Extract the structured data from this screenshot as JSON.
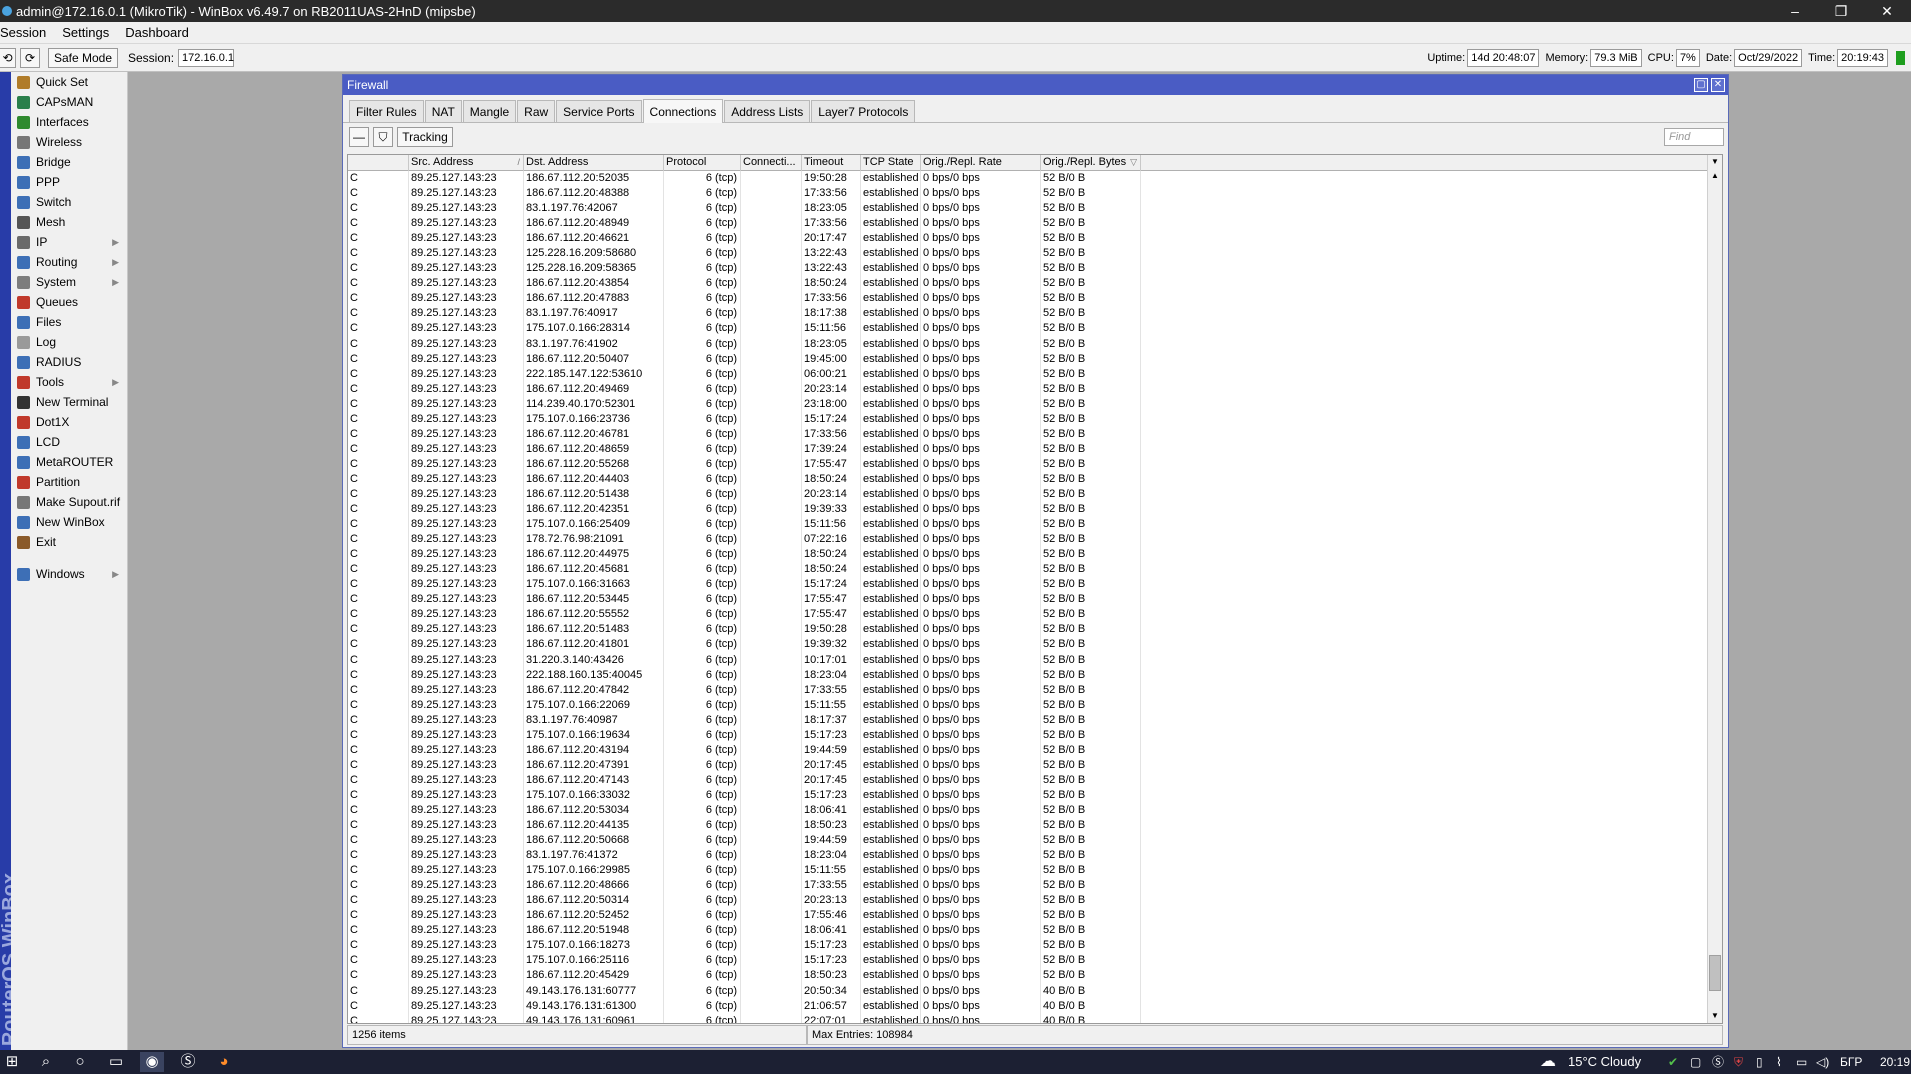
{
  "window": {
    "title": "admin@172.16.0.1 (MikroTik) - WinBox v6.49.7 on RB2011UAS-2HnD (mipsbe)",
    "controls": [
      "–",
      "❐",
      "✕"
    ]
  },
  "menu": [
    "Session",
    "Settings",
    "Dashboard"
  ],
  "toolbar": {
    "safe_mode": "Safe Mode",
    "session_label": "Session:",
    "session_value": "172.16.0.1",
    "uptime_label": "Uptime:",
    "uptime_value": "14d 20:48:07",
    "memory_label": "Memory:",
    "memory_value": "79.3 MiB",
    "cpu_label": "CPU:",
    "cpu_value": "7%",
    "date_label": "Date:",
    "date_value": "Oct/29/2022",
    "time_label": "Time:",
    "time_value": "20:19:43"
  },
  "brand_vertical": "RouterOS WinBox",
  "sidebar": [
    {
      "label": "Quick Set",
      "icon": "wand-icon",
      "color": "#b07c2a"
    },
    {
      "label": "CAPsMAN",
      "icon": "capsman-icon",
      "color": "#2a7f4b"
    },
    {
      "label": "Interfaces",
      "icon": "interfaces-icon",
      "color": "#2f8a2f"
    },
    {
      "label": "Wireless",
      "icon": "wireless-icon",
      "color": "#777777"
    },
    {
      "label": "Bridge",
      "icon": "bridge-icon",
      "color": "#3d6fb6"
    },
    {
      "label": "PPP",
      "icon": "ppp-icon",
      "color": "#3d6fb6"
    },
    {
      "label": "Switch",
      "icon": "switch-icon",
      "color": "#3d6fb6"
    },
    {
      "label": "Mesh",
      "icon": "mesh-icon",
      "color": "#555555"
    },
    {
      "label": "IP",
      "icon": "ip-icon",
      "color": "#6a6a6a",
      "submenu": true
    },
    {
      "label": "Routing",
      "icon": "routing-icon",
      "color": "#3d6fb6",
      "submenu": true
    },
    {
      "label": "System",
      "icon": "system-icon",
      "color": "#7d7d7d",
      "submenu": true
    },
    {
      "label": "Queues",
      "icon": "queues-icon",
      "color": "#c0392b"
    },
    {
      "label": "Files",
      "icon": "files-icon",
      "color": "#3d6fb6"
    },
    {
      "label": "Log",
      "icon": "log-icon",
      "color": "#9a9a9a"
    },
    {
      "label": "RADIUS",
      "icon": "radius-icon",
      "color": "#3d6fb6"
    },
    {
      "label": "Tools",
      "icon": "tools-icon",
      "color": "#c0392b",
      "submenu": true
    },
    {
      "label": "New Terminal",
      "icon": "terminal-icon",
      "color": "#333333"
    },
    {
      "label": "Dot1X",
      "icon": "dot1x-icon",
      "color": "#c0392b"
    },
    {
      "label": "LCD",
      "icon": "lcd-icon",
      "color": "#3d6fb6"
    },
    {
      "label": "MetaROUTER",
      "icon": "metarouter-icon",
      "color": "#3d6fb6"
    },
    {
      "label": "Partition",
      "icon": "partition-icon",
      "color": "#c0392b"
    },
    {
      "label": "Make Supout.rif",
      "icon": "supout-icon",
      "color": "#777777"
    },
    {
      "label": "New WinBox",
      "icon": "winbox-icon",
      "color": "#3d6fb6"
    },
    {
      "label": "Exit",
      "icon": "exit-icon",
      "color": "#8a5a2a"
    }
  ],
  "sidebar_windows": {
    "label": "Windows",
    "icon": "windows-icon",
    "color": "#3d6fb6"
  },
  "firewall": {
    "title": "Firewall",
    "tabs": [
      "Filter Rules",
      "NAT",
      "Mangle",
      "Raw",
      "Service Ports",
      "Connections",
      "Address Lists",
      "Layer7 Protocols"
    ],
    "active_tab": "Connections",
    "tracking_button": "Tracking",
    "find_placeholder": "Find",
    "columns": [
      "",
      "Src. Address",
      "Dst. Address",
      "Protocol",
      "Connecti...",
      "Timeout",
      "TCP State",
      "Orig./Repl. Rate",
      "Orig./Repl. Bytes"
    ],
    "rows": [
      [
        "C",
        "89.25.127.143:23",
        "186.67.112.20:52035",
        "6 (tcp)",
        "",
        "19:50:28",
        "established",
        "0 bps/0 bps",
        "52 B/0 B"
      ],
      [
        "C",
        "89.25.127.143:23",
        "186.67.112.20:48388",
        "6 (tcp)",
        "",
        "17:33:56",
        "established",
        "0 bps/0 bps",
        "52 B/0 B"
      ],
      [
        "C",
        "89.25.127.143:23",
        "83.1.197.76:42067",
        "6 (tcp)",
        "",
        "18:23:05",
        "established",
        "0 bps/0 bps",
        "52 B/0 B"
      ],
      [
        "C",
        "89.25.127.143:23",
        "186.67.112.20:48949",
        "6 (tcp)",
        "",
        "17:33:56",
        "established",
        "0 bps/0 bps",
        "52 B/0 B"
      ],
      [
        "C",
        "89.25.127.143:23",
        "186.67.112.20:46621",
        "6 (tcp)",
        "",
        "20:17:47",
        "established",
        "0 bps/0 bps",
        "52 B/0 B"
      ],
      [
        "C",
        "89.25.127.143:23",
        "125.228.16.209:58680",
        "6 (tcp)",
        "",
        "13:22:43",
        "established",
        "0 bps/0 bps",
        "52 B/0 B"
      ],
      [
        "C",
        "89.25.127.143:23",
        "125.228.16.209:58365",
        "6 (tcp)",
        "",
        "13:22:43",
        "established",
        "0 bps/0 bps",
        "52 B/0 B"
      ],
      [
        "C",
        "89.25.127.143:23",
        "186.67.112.20:43854",
        "6 (tcp)",
        "",
        "18:50:24",
        "established",
        "0 bps/0 bps",
        "52 B/0 B"
      ],
      [
        "C",
        "89.25.127.143:23",
        "186.67.112.20:47883",
        "6 (tcp)",
        "",
        "17:33:56",
        "established",
        "0 bps/0 bps",
        "52 B/0 B"
      ],
      [
        "C",
        "89.25.127.143:23",
        "83.1.197.76:40917",
        "6 (tcp)",
        "",
        "18:17:38",
        "established",
        "0 bps/0 bps",
        "52 B/0 B"
      ],
      [
        "C",
        "89.25.127.143:23",
        "175.107.0.166:28314",
        "6 (tcp)",
        "",
        "15:11:56",
        "established",
        "0 bps/0 bps",
        "52 B/0 B"
      ],
      [
        "C",
        "89.25.127.143:23",
        "83.1.197.76:41902",
        "6 (tcp)",
        "",
        "18:23:05",
        "established",
        "0 bps/0 bps",
        "52 B/0 B"
      ],
      [
        "C",
        "89.25.127.143:23",
        "186.67.112.20:50407",
        "6 (tcp)",
        "",
        "19:45:00",
        "established",
        "0 bps/0 bps",
        "52 B/0 B"
      ],
      [
        "C",
        "89.25.127.143:23",
        "222.185.147.122:53610",
        "6 (tcp)",
        "",
        "06:00:21",
        "established",
        "0 bps/0 bps",
        "52 B/0 B"
      ],
      [
        "C",
        "89.25.127.143:23",
        "186.67.112.20:49469",
        "6 (tcp)",
        "",
        "20:23:14",
        "established",
        "0 bps/0 bps",
        "52 B/0 B"
      ],
      [
        "C",
        "89.25.127.143:23",
        "114.239.40.170:52301",
        "6 (tcp)",
        "",
        "23:18:00",
        "established",
        "0 bps/0 bps",
        "52 B/0 B"
      ],
      [
        "C",
        "89.25.127.143:23",
        "175.107.0.166:23736",
        "6 (tcp)",
        "",
        "15:17:24",
        "established",
        "0 bps/0 bps",
        "52 B/0 B"
      ],
      [
        "C",
        "89.25.127.143:23",
        "186.67.112.20:46781",
        "6 (tcp)",
        "",
        "17:33:56",
        "established",
        "0 bps/0 bps",
        "52 B/0 B"
      ],
      [
        "C",
        "89.25.127.143:23",
        "186.67.112.20:48659",
        "6 (tcp)",
        "",
        "17:39:24",
        "established",
        "0 bps/0 bps",
        "52 B/0 B"
      ],
      [
        "C",
        "89.25.127.143:23",
        "186.67.112.20:55268",
        "6 (tcp)",
        "",
        "17:55:47",
        "established",
        "0 bps/0 bps",
        "52 B/0 B"
      ],
      [
        "C",
        "89.25.127.143:23",
        "186.67.112.20:44403",
        "6 (tcp)",
        "",
        "18:50:24",
        "established",
        "0 bps/0 bps",
        "52 B/0 B"
      ],
      [
        "C",
        "89.25.127.143:23",
        "186.67.112.20:51438",
        "6 (tcp)",
        "",
        "20:23:14",
        "established",
        "0 bps/0 bps",
        "52 B/0 B"
      ],
      [
        "C",
        "89.25.127.143:23",
        "186.67.112.20:42351",
        "6 (tcp)",
        "",
        "19:39:33",
        "established",
        "0 bps/0 bps",
        "52 B/0 B"
      ],
      [
        "C",
        "89.25.127.143:23",
        "175.107.0.166:25409",
        "6 (tcp)",
        "",
        "15:11:56",
        "established",
        "0 bps/0 bps",
        "52 B/0 B"
      ],
      [
        "C",
        "89.25.127.143:23",
        "178.72.76.98:21091",
        "6 (tcp)",
        "",
        "07:22:16",
        "established",
        "0 bps/0 bps",
        "52 B/0 B"
      ],
      [
        "C",
        "89.25.127.143:23",
        "186.67.112.20:44975",
        "6 (tcp)",
        "",
        "18:50:24",
        "established",
        "0 bps/0 bps",
        "52 B/0 B"
      ],
      [
        "C",
        "89.25.127.143:23",
        "186.67.112.20:45681",
        "6 (tcp)",
        "",
        "18:50:24",
        "established",
        "0 bps/0 bps",
        "52 B/0 B"
      ],
      [
        "C",
        "89.25.127.143:23",
        "175.107.0.166:31663",
        "6 (tcp)",
        "",
        "15:17:24",
        "established",
        "0 bps/0 bps",
        "52 B/0 B"
      ],
      [
        "C",
        "89.25.127.143:23",
        "186.67.112.20:53445",
        "6 (tcp)",
        "",
        "17:55:47",
        "established",
        "0 bps/0 bps",
        "52 B/0 B"
      ],
      [
        "C",
        "89.25.127.143:23",
        "186.67.112.20:55552",
        "6 (tcp)",
        "",
        "17:55:47",
        "established",
        "0 bps/0 bps",
        "52 B/0 B"
      ],
      [
        "C",
        "89.25.127.143:23",
        "186.67.112.20:51483",
        "6 (tcp)",
        "",
        "19:50:28",
        "established",
        "0 bps/0 bps",
        "52 B/0 B"
      ],
      [
        "C",
        "89.25.127.143:23",
        "186.67.112.20:41801",
        "6 (tcp)",
        "",
        "19:39:32",
        "established",
        "0 bps/0 bps",
        "52 B/0 B"
      ],
      [
        "C",
        "89.25.127.143:23",
        "31.220.3.140:43426",
        "6 (tcp)",
        "",
        "10:17:01",
        "established",
        "0 bps/0 bps",
        "52 B/0 B"
      ],
      [
        "C",
        "89.25.127.143:23",
        "222.188.160.135:40045",
        "6 (tcp)",
        "",
        "18:23:04",
        "established",
        "0 bps/0 bps",
        "52 B/0 B"
      ],
      [
        "C",
        "89.25.127.143:23",
        "186.67.112.20:47842",
        "6 (tcp)",
        "",
        "17:33:55",
        "established",
        "0 bps/0 bps",
        "52 B/0 B"
      ],
      [
        "C",
        "89.25.127.143:23",
        "175.107.0.166:22069",
        "6 (tcp)",
        "",
        "15:11:55",
        "established",
        "0 bps/0 bps",
        "52 B/0 B"
      ],
      [
        "C",
        "89.25.127.143:23",
        "83.1.197.76:40987",
        "6 (tcp)",
        "",
        "18:17:37",
        "established",
        "0 bps/0 bps",
        "52 B/0 B"
      ],
      [
        "C",
        "89.25.127.143:23",
        "175.107.0.166:19634",
        "6 (tcp)",
        "",
        "15:17:23",
        "established",
        "0 bps/0 bps",
        "52 B/0 B"
      ],
      [
        "C",
        "89.25.127.143:23",
        "186.67.112.20:43194",
        "6 (tcp)",
        "",
        "19:44:59",
        "established",
        "0 bps/0 bps",
        "52 B/0 B"
      ],
      [
        "C",
        "89.25.127.143:23",
        "186.67.112.20:47391",
        "6 (tcp)",
        "",
        "20:17:45",
        "established",
        "0 bps/0 bps",
        "52 B/0 B"
      ],
      [
        "C",
        "89.25.127.143:23",
        "186.67.112.20:47143",
        "6 (tcp)",
        "",
        "20:17:45",
        "established",
        "0 bps/0 bps",
        "52 B/0 B"
      ],
      [
        "C",
        "89.25.127.143:23",
        "175.107.0.166:33032",
        "6 (tcp)",
        "",
        "15:17:23",
        "established",
        "0 bps/0 bps",
        "52 B/0 B"
      ],
      [
        "C",
        "89.25.127.143:23",
        "186.67.112.20:53034",
        "6 (tcp)",
        "",
        "18:06:41",
        "established",
        "0 bps/0 bps",
        "52 B/0 B"
      ],
      [
        "C",
        "89.25.127.143:23",
        "186.67.112.20:44135",
        "6 (tcp)",
        "",
        "18:50:23",
        "established",
        "0 bps/0 bps",
        "52 B/0 B"
      ],
      [
        "C",
        "89.25.127.143:23",
        "186.67.112.20:50668",
        "6 (tcp)",
        "",
        "19:44:59",
        "established",
        "0 bps/0 bps",
        "52 B/0 B"
      ],
      [
        "C",
        "89.25.127.143:23",
        "83.1.197.76:41372",
        "6 (tcp)",
        "",
        "18:23:04",
        "established",
        "0 bps/0 bps",
        "52 B/0 B"
      ],
      [
        "C",
        "89.25.127.143:23",
        "175.107.0.166:29985",
        "6 (tcp)",
        "",
        "15:11:55",
        "established",
        "0 bps/0 bps",
        "52 B/0 B"
      ],
      [
        "C",
        "89.25.127.143:23",
        "186.67.112.20:48666",
        "6 (tcp)",
        "",
        "17:33:55",
        "established",
        "0 bps/0 bps",
        "52 B/0 B"
      ],
      [
        "C",
        "89.25.127.143:23",
        "186.67.112.20:50314",
        "6 (tcp)",
        "",
        "20:23:13",
        "established",
        "0 bps/0 bps",
        "52 B/0 B"
      ],
      [
        "C",
        "89.25.127.143:23",
        "186.67.112.20:52452",
        "6 (tcp)",
        "",
        "17:55:46",
        "established",
        "0 bps/0 bps",
        "52 B/0 B"
      ],
      [
        "C",
        "89.25.127.143:23",
        "186.67.112.20:51948",
        "6 (tcp)",
        "",
        "18:06:41",
        "established",
        "0 bps/0 bps",
        "52 B/0 B"
      ],
      [
        "C",
        "89.25.127.143:23",
        "175.107.0.166:18273",
        "6 (tcp)",
        "",
        "15:17:23",
        "established",
        "0 bps/0 bps",
        "52 B/0 B"
      ],
      [
        "C",
        "89.25.127.143:23",
        "175.107.0.166:25116",
        "6 (tcp)",
        "",
        "15:17:23",
        "established",
        "0 bps/0 bps",
        "52 B/0 B"
      ],
      [
        "C",
        "89.25.127.143:23",
        "186.67.112.20:45429",
        "6 (tcp)",
        "",
        "18:50:23",
        "established",
        "0 bps/0 bps",
        "52 B/0 B"
      ],
      [
        "C",
        "89.25.127.143:23",
        "49.143.176.131:60777",
        "6 (tcp)",
        "",
        "20:50:34",
        "established",
        "0 bps/0 bps",
        "40 B/0 B"
      ],
      [
        "C",
        "89.25.127.143:23",
        "49.143.176.131:61300",
        "6 (tcp)",
        "",
        "21:06:57",
        "established",
        "0 bps/0 bps",
        "40 B/0 B"
      ],
      [
        "C",
        "89.25.127.143:23",
        "49.143.176.131:60961",
        "6 (tcp)",
        "",
        "22:07:01",
        "established",
        "0 bps/0 bps",
        "40 B/0 B"
      ]
    ],
    "status_items": "1256 items",
    "status_max": "Max Entries: 108984"
  },
  "taskbar": {
    "weather": "15°C  Cloudy",
    "lang": "БГР",
    "time": "20:19"
  }
}
